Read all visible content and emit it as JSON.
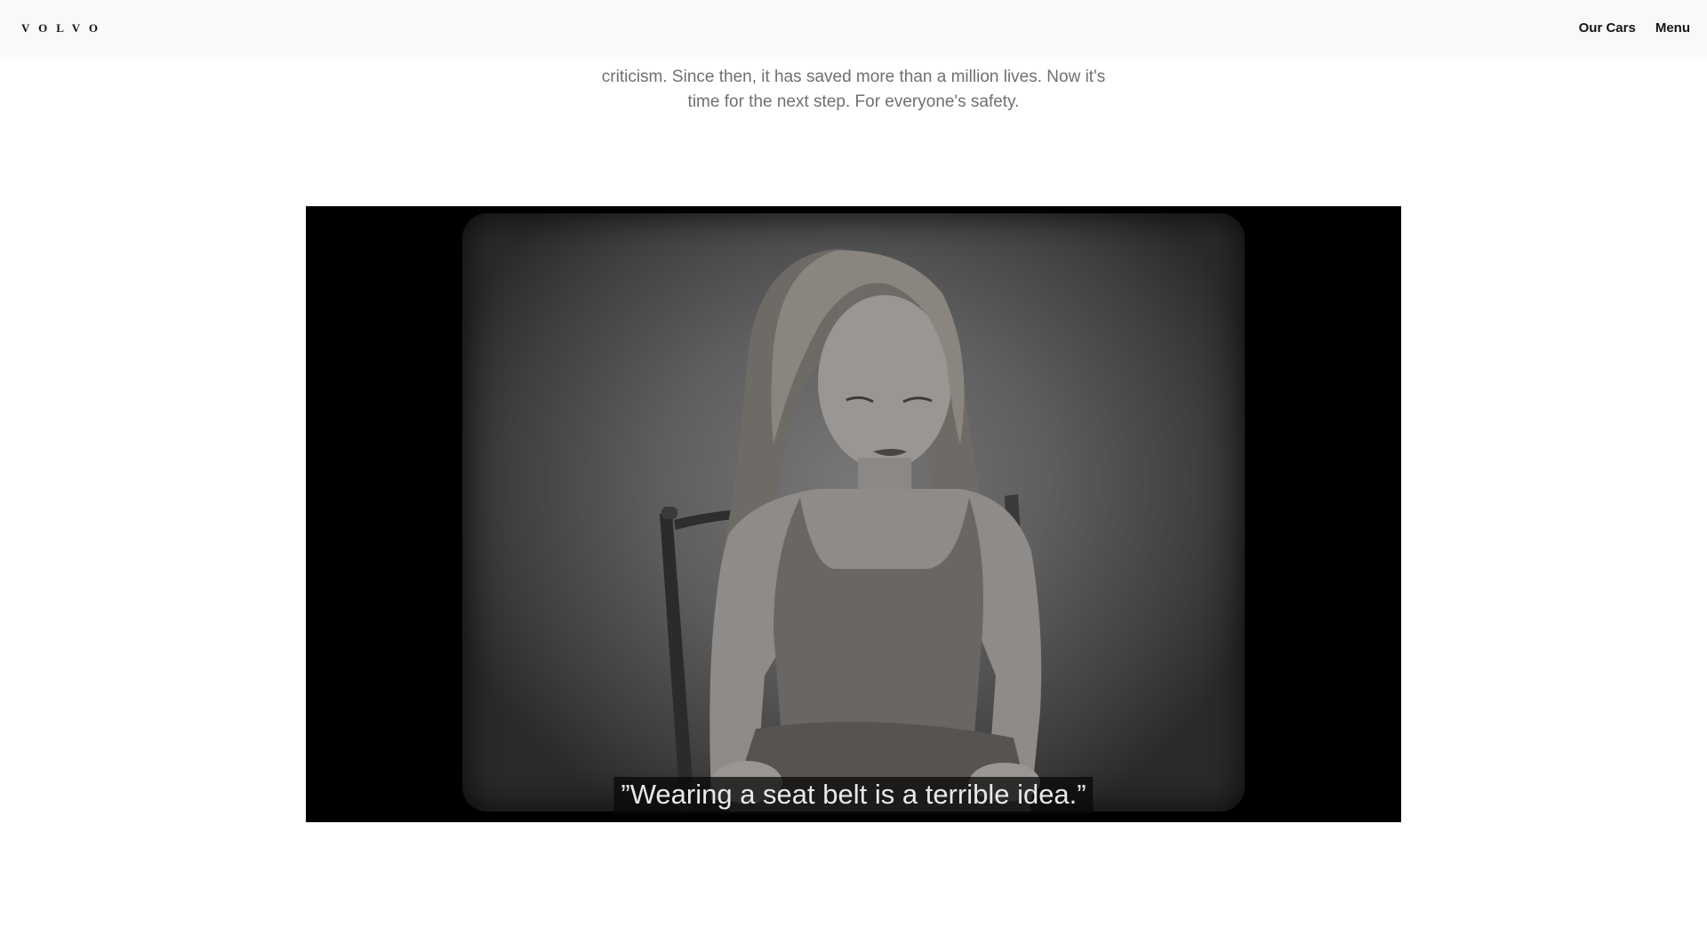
{
  "header": {
    "logo": "VOLVO",
    "nav": [
      "Our Cars",
      "Menu"
    ]
  },
  "intro": {
    "line2": "criticism. Since then, it has saved more than a million lives. Now it's",
    "line3": "time for the next step. For everyone's safety."
  },
  "video": {
    "subtitle": "”Wearing a seat belt is a terrible idea.”"
  },
  "colors": {
    "header_bg": "#f9f9f9",
    "body_text": "#707070",
    "video_bg": "#000000"
  }
}
